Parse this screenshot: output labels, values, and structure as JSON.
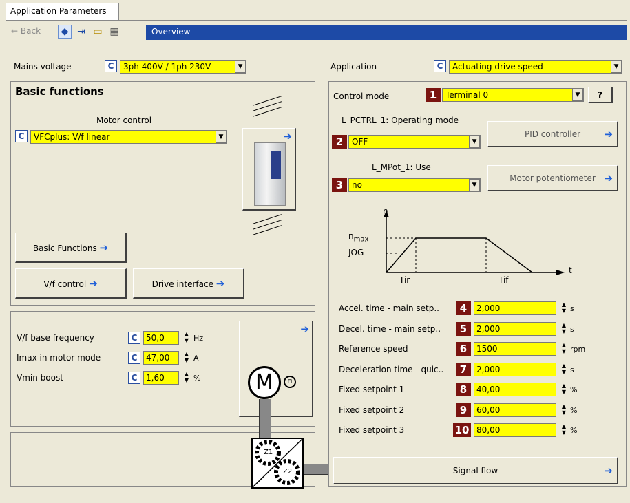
{
  "tab": {
    "label": "Application Parameters"
  },
  "toolbar": {
    "back_label": "Back",
    "overview_label": "Overview"
  },
  "mains": {
    "label": "Mains voltage",
    "value": "3ph 400V / 1ph 230V",
    "c": "C"
  },
  "application": {
    "label": "Application",
    "value": "Actuating drive speed",
    "c": "C"
  },
  "basic": {
    "title": "Basic functions",
    "motor_control_label": "Motor control",
    "motor_control_value": "VFCplus: V/f linear",
    "c": "C",
    "btn_basic": "Basic Functions",
    "btn_vf": "V/f control",
    "btn_drive": "Drive interface"
  },
  "vf": {
    "rows": [
      {
        "label": "V/f base frequency",
        "value": "50,0",
        "unit": "Hz",
        "c": "C"
      },
      {
        "label": "Imax in motor mode",
        "value": "47,00",
        "unit": "A",
        "c": "C"
      },
      {
        "label": "Vmin boost",
        "value": "1,60",
        "unit": "%",
        "c": "C"
      }
    ]
  },
  "motor": {
    "symbol": "M",
    "gear1": "Z1",
    "gear2": "Z2"
  },
  "control": {
    "mode_label": "Control mode",
    "mode_num": "1",
    "mode_value": "Terminal 0",
    "help": "?",
    "pctrl_label": "L_PCTRL_1: Operating mode",
    "pctrl_num": "2",
    "pctrl_value": "OFF",
    "pid_btn": "PID controller",
    "mpot_label": "L_MPot_1: Use",
    "mpot_num": "3",
    "mpot_value": "no",
    "mpot_btn": "Motor potentiometer",
    "signal_btn": "Signal flow"
  },
  "graph": {
    "n": "n",
    "nmax": "n",
    "max": "max",
    "jog": "JOG",
    "t": "t",
    "tir": "Tir",
    "tif": "Tif"
  },
  "params": [
    {
      "label": "Accel. time - main setp..",
      "num": "4",
      "value": "2,000",
      "unit": "s"
    },
    {
      "label": "Decel. time - main setp..",
      "num": "5",
      "value": "2,000",
      "unit": "s"
    },
    {
      "label": "Reference speed",
      "num": "6",
      "value": "1500",
      "unit": "rpm"
    },
    {
      "label": "Deceleration time - quic..",
      "num": "7",
      "value": "2,000",
      "unit": "s"
    },
    {
      "label": "Fixed setpoint 1",
      "num": "8",
      "value": "40,00",
      "unit": "%"
    },
    {
      "label": "Fixed setpoint 2",
      "num": "9",
      "value": "60,00",
      "unit": "%"
    },
    {
      "label": "Fixed setpoint 3",
      "num": "10",
      "value": "80,00",
      "unit": "%"
    }
  ],
  "icons": {
    "arrow": "arrow-right-icon",
    "dropdown": "chevron-down-icon"
  },
  "colors": {
    "accent_yellow": "#ffff00",
    "badge": "#7a1410",
    "overview_bar": "#1d4aa6",
    "arrow": "#2060d8"
  }
}
